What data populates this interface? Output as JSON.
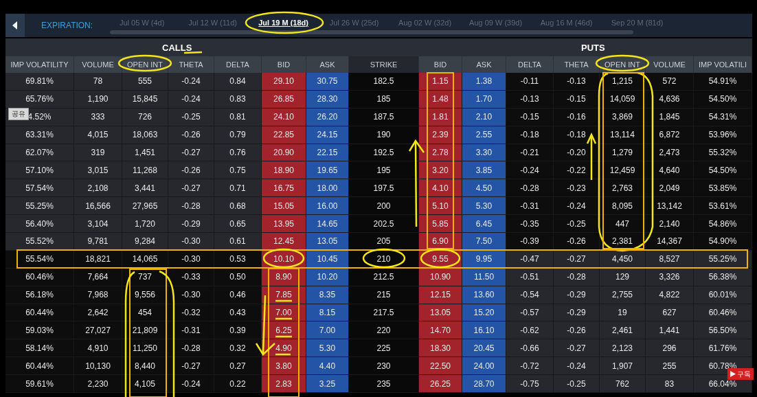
{
  "expiration": {
    "label": "EXPIRATION:",
    "dates": [
      {
        "label": "Jul 05 W (4d)",
        "selected": false
      },
      {
        "label": "Jul 12 W (11d)",
        "selected": false
      },
      {
        "label": "Jul 19 M (18d)",
        "selected": true
      },
      {
        "label": "Jul 26 W (25d)",
        "selected": false
      },
      {
        "label": "Aug 02 W (32d)",
        "selected": false
      },
      {
        "label": "Aug 09 W (39d)",
        "selected": false
      },
      {
        "label": "Aug 16 M (46d)",
        "selected": false
      },
      {
        "label": "Sep 20 M (81d)",
        "selected": false
      }
    ]
  },
  "sections": {
    "calls": "CALLS",
    "puts": "PUTS"
  },
  "columns": [
    "IMP VOLATILITY",
    "VOLUME",
    "OPEN INT",
    "THETA",
    "DELTA",
    "BID",
    "ASK",
    "STRIKE",
    "BID",
    "ASK",
    "DELTA",
    "THETA",
    "OPEN INT",
    "VOLUME",
    "IMP VOLATILI"
  ],
  "rows": [
    {
      "calls_itm": true,
      "puts_itm": false,
      "calls": [
        "69.81%",
        "78",
        "555",
        "-0.24",
        "0.84",
        "29.10",
        "30.75"
      ],
      "strike": "182.5",
      "puts": [
        "1.15",
        "1.38",
        "-0.11",
        "-0.13",
        "1,215",
        "572",
        "54.91%"
      ]
    },
    {
      "calls_itm": true,
      "puts_itm": false,
      "calls": [
        "65.76%",
        "1,190",
        "15,845",
        "-0.24",
        "0.83",
        "26.85",
        "28.30"
      ],
      "strike": "185",
      "puts": [
        "1.48",
        "1.70",
        "-0.13",
        "-0.15",
        "14,059",
        "4,636",
        "54.50%"
      ]
    },
    {
      "calls_itm": true,
      "puts_itm": false,
      "calls": [
        "4.52%",
        "333",
        "726",
        "-0.25",
        "0.81",
        "24.10",
        "26.20"
      ],
      "strike": "187.5",
      "puts": [
        "1.81",
        "2.10",
        "-0.15",
        "-0.16",
        "3,869",
        "1,845",
        "54.31%"
      ]
    },
    {
      "calls_itm": true,
      "puts_itm": false,
      "calls": [
        "63.31%",
        "4,015",
        "18,063",
        "-0.26",
        "0.79",
        "22.85",
        "24.15"
      ],
      "strike": "190",
      "puts": [
        "2.39",
        "2.55",
        "-0.18",
        "-0.18",
        "13,114",
        "6,872",
        "53.96%"
      ]
    },
    {
      "calls_itm": true,
      "puts_itm": false,
      "calls": [
        "62.07%",
        "319",
        "1,451",
        "-0.27",
        "0.76",
        "20.90",
        "22.15"
      ],
      "strike": "192.5",
      "puts": [
        "2.78",
        "3.30",
        "-0.21",
        "-0.20",
        "1,279",
        "2,473",
        "55.32%"
      ]
    },
    {
      "calls_itm": true,
      "puts_itm": false,
      "calls": [
        "57.10%",
        "3,015",
        "11,268",
        "-0.26",
        "0.75",
        "18.90",
        "19.65"
      ],
      "strike": "195",
      "puts": [
        "3.20",
        "3.85",
        "-0.24",
        "-0.22",
        "12,459",
        "4,640",
        "54.50%"
      ]
    },
    {
      "calls_itm": true,
      "puts_itm": false,
      "calls": [
        "57.54%",
        "2,108",
        "3,441",
        "-0.27",
        "0.71",
        "16.75",
        "18.00"
      ],
      "strike": "197.5",
      "puts": [
        "4.10",
        "4.50",
        "-0.28",
        "-0.23",
        "2,763",
        "2,049",
        "53.85%"
      ]
    },
    {
      "calls_itm": true,
      "puts_itm": false,
      "calls": [
        "55.25%",
        "16,566",
        "27,965",
        "-0.28",
        "0.68",
        "15.05",
        "16.00"
      ],
      "strike": "200",
      "puts": [
        "5.10",
        "5.30",
        "-0.31",
        "-0.24",
        "8,095",
        "13,142",
        "53.61%"
      ]
    },
    {
      "calls_itm": true,
      "puts_itm": false,
      "calls": [
        "56.40%",
        "3,104",
        "1,720",
        "-0.29",
        "0.65",
        "13.95",
        "14.65"
      ],
      "strike": "202.5",
      "puts": [
        "5.85",
        "6.45",
        "-0.35",
        "-0.25",
        "447",
        "2,140",
        "54.86%"
      ]
    },
    {
      "calls_itm": true,
      "puts_itm": false,
      "calls": [
        "55.52%",
        "9,781",
        "9,284",
        "-0.30",
        "0.61",
        "12.45",
        "13.05"
      ],
      "strike": "205",
      "puts": [
        "6.90",
        "7.50",
        "-0.39",
        "-0.26",
        "2,381",
        "14,367",
        "54.90%"
      ]
    },
    {
      "calls_itm": false,
      "puts_itm": true,
      "calls": [
        "55.54%",
        "18,821",
        "14,065",
        "-0.30",
        "0.53",
        "10.10",
        "10.45"
      ],
      "strike": "210",
      "puts": [
        "9.55",
        "9.95",
        "-0.47",
        "-0.27",
        "4,450",
        "8,527",
        "55.25%"
      ]
    },
    {
      "calls_itm": false,
      "puts_itm": true,
      "calls": [
        "60.46%",
        "7,664",
        "737",
        "-0.33",
        "0.50",
        "8.90",
        "10.20"
      ],
      "strike": "212.5",
      "puts": [
        "10.90",
        "11.50",
        "-0.51",
        "-0.28",
        "129",
        "3,326",
        "56.38%"
      ]
    },
    {
      "calls_itm": false,
      "puts_itm": true,
      "calls": [
        "56.18%",
        "7,968",
        "9,556",
        "-0.30",
        "0.46",
        "7.85",
        "8.35"
      ],
      "strike": "215",
      "puts": [
        "12.15",
        "13.60",
        "-0.54",
        "-0.29",
        "2,755",
        "4,822",
        "60.01%"
      ]
    },
    {
      "calls_itm": false,
      "puts_itm": true,
      "calls": [
        "60.44%",
        "2,642",
        "454",
        "-0.32",
        "0.43",
        "7.00",
        "8.15"
      ],
      "strike": "217.5",
      "puts": [
        "13.05",
        "15.20",
        "-0.57",
        "-0.29",
        "19",
        "627",
        "60.46%"
      ]
    },
    {
      "calls_itm": false,
      "puts_itm": true,
      "calls": [
        "59.03%",
        "27,027",
        "21,809",
        "-0.31",
        "0.39",
        "6.25",
        "7.00"
      ],
      "strike": "220",
      "puts": [
        "14.70",
        "16.10",
        "-0.62",
        "-0.26",
        "2,461",
        "1,441",
        "56.50%"
      ]
    },
    {
      "calls_itm": false,
      "puts_itm": true,
      "calls": [
        "58.14%",
        "4,910",
        "11,250",
        "-0.28",
        "0.32",
        "4.90",
        "5.30"
      ],
      "strike": "225",
      "puts": [
        "18.30",
        "20.45",
        "-0.66",
        "-0.27",
        "2,123",
        "296",
        "61.76%"
      ]
    },
    {
      "calls_itm": false,
      "puts_itm": true,
      "calls": [
        "60.44%",
        "10,130",
        "8,440",
        "-0.27",
        "0.27",
        "3.80",
        "4.40"
      ],
      "strike": "230",
      "puts": [
        "22.50",
        "24.00",
        "-0.72",
        "-0.24",
        "1,907",
        "255",
        "60.78%"
      ]
    },
    {
      "calls_itm": false,
      "puts_itm": true,
      "calls": [
        "59.61%",
        "2,230",
        "4,105",
        "-0.24",
        "0.22",
        "2.83",
        "3.25"
      ],
      "strike": "235",
      "puts": [
        "26.25",
        "28.70",
        "-0.75",
        "-0.25",
        "762",
        "83",
        "66.04%"
      ]
    }
  ],
  "share_button": {
    "label": "공유"
  },
  "subscribe_badge": {
    "label": "구독"
  }
}
